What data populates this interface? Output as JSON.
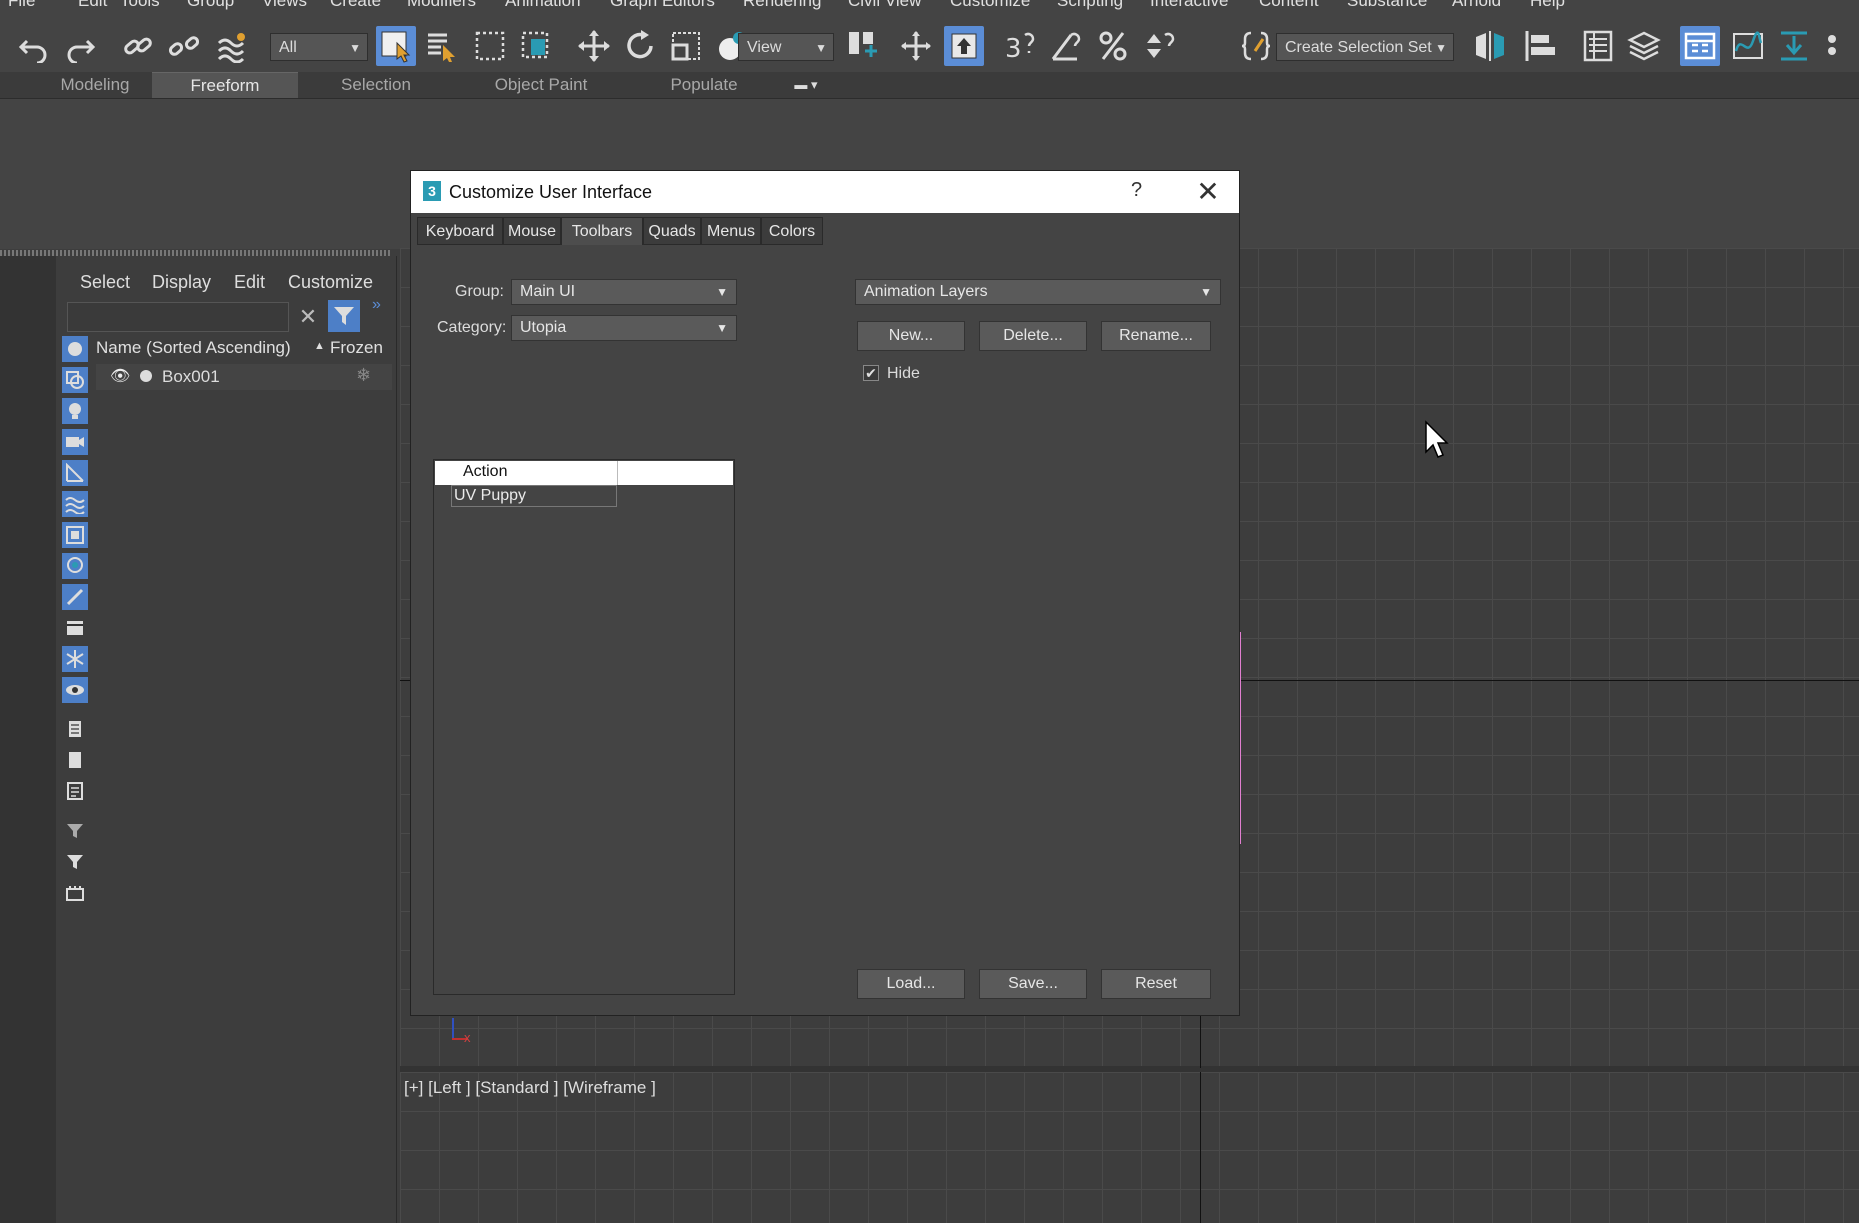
{
  "menubar": {
    "items": [
      "File",
      "Edit",
      "Tools",
      "Group",
      "Views",
      "Create",
      "Modifiers",
      "Animation",
      "Graph Editors",
      "Rendering",
      "Civil View",
      "Customize",
      "Scripting",
      "Interactive",
      "Content",
      "Substance",
      "Arnold",
      "Help"
    ]
  },
  "toolbar": {
    "filter_combo": "All",
    "refcoord_combo": "View",
    "selection_set_combo": "Create Selection Set",
    "snap_label": "3"
  },
  "ribbon": {
    "tabs": [
      "Modeling",
      "Freeform",
      "Selection",
      "Object Paint",
      "Populate"
    ],
    "active_tab": "Freeform"
  },
  "explorer": {
    "menu": [
      "Select",
      "Display",
      "Edit",
      "Customize"
    ],
    "columns": {
      "name": "Name (Sorted Ascending)",
      "frozen": "Frozen"
    },
    "rows": [
      {
        "name": "Box001"
      }
    ]
  },
  "viewport": {
    "label": "[+] [Left ] [Standard ] [Wireframe ]",
    "axis_label": "x"
  },
  "dialog": {
    "title": "Customize User Interface",
    "help": "?",
    "logo": "3",
    "tabs": [
      "Keyboard",
      "Mouse",
      "Toolbars",
      "Quads",
      "Menus",
      "Colors"
    ],
    "active_tab": "Toolbars",
    "group_label": "Group:",
    "group_value": "Main UI",
    "category_label": "Category:",
    "category_value": "Utopia",
    "list_header": "Action",
    "list_items": [
      "UV Puppy"
    ],
    "toolbar_select": "Animation Layers",
    "buttons": {
      "new": "New...",
      "delete": "Delete...",
      "rename": "Rename...",
      "load": "Load...",
      "save": "Save...",
      "reset": "Reset"
    },
    "hide_label": "Hide",
    "hide_checked": true
  },
  "colors": {
    "accent": "#5b8dd6",
    "teal": "#2a9bb3"
  }
}
